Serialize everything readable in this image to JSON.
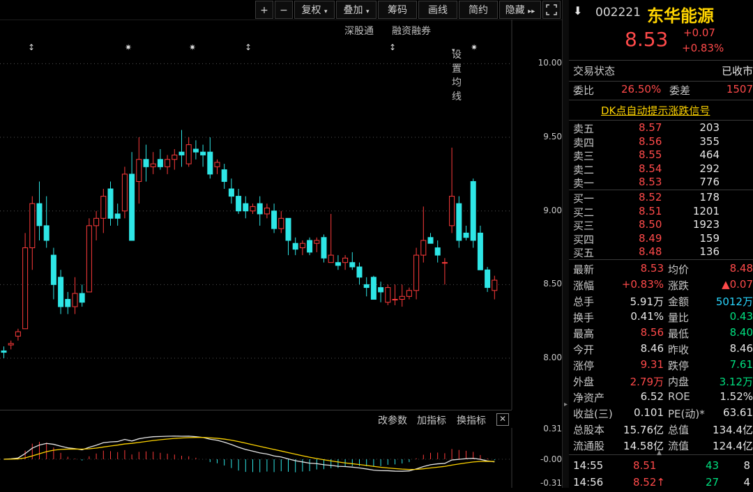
{
  "toolbar": {
    "plus": "+",
    "minus": "−",
    "fuquan": "复权",
    "diejia": "叠加",
    "chouma": "筹码",
    "huaxian": "画线",
    "jianyue": "简约",
    "yincang": "隐藏",
    "expand_icon": "expand-icon"
  },
  "subbar": {
    "shengutong": "深股通",
    "rongzi": "融资融券",
    "junxian": "设置均线"
  },
  "macd_bar": {
    "gaicanshu": "改参数",
    "jiazhibiao": "加指标",
    "huanzhibiao": "换指标"
  },
  "stock": {
    "code": "002221",
    "name": "东华能源",
    "price": "8.53",
    "change": "+0.07",
    "change_pct": "+0.83%"
  },
  "status": {
    "label": "交易状态",
    "value": "已收市"
  },
  "ratio": {
    "wb_label": "委比",
    "wb_value": "26.50%",
    "wc_label": "委差",
    "wc_value": "1507"
  },
  "dk_link": "DK点自动提示涨跌信号",
  "sell": [
    {
      "label": "卖五",
      "price": "8.57",
      "vol": "203"
    },
    {
      "label": "卖四",
      "price": "8.56",
      "vol": "355"
    },
    {
      "label": "卖三",
      "price": "8.55",
      "vol": "464"
    },
    {
      "label": "卖二",
      "price": "8.54",
      "vol": "292"
    },
    {
      "label": "卖一",
      "price": "8.53",
      "vol": "776"
    }
  ],
  "buy": [
    {
      "label": "买一",
      "price": "8.52",
      "vol": "178"
    },
    {
      "label": "买二",
      "price": "8.51",
      "vol": "1201"
    },
    {
      "label": "买三",
      "price": "8.50",
      "vol": "1923"
    },
    {
      "label": "买四",
      "price": "8.49",
      "vol": "159"
    },
    {
      "label": "买五",
      "price": "8.48",
      "vol": "136"
    }
  ],
  "stats": [
    {
      "l1": "最新",
      "v1": "8.53",
      "c1": "red",
      "l2": "均价",
      "v2": "8.48",
      "c2": "red"
    },
    {
      "l1": "涨幅",
      "v1": "+0.83%",
      "c1": "red",
      "l2": "涨跌",
      "v2": "▲0.07",
      "c2": "red"
    },
    {
      "l1": "总手",
      "v1": "5.91万",
      "c1": "white",
      "l2": "金额",
      "v2": "5012万",
      "c2": "cyan"
    },
    {
      "l1": "换手",
      "v1": "0.41%",
      "c1": "white",
      "l2": "量比",
      "v2": "0.43",
      "c2": "green"
    },
    {
      "l1": "最高",
      "v1": "8.56",
      "c1": "red",
      "l2": "最低",
      "v2": "8.40",
      "c2": "green"
    },
    {
      "l1": "今开",
      "v1": "8.46",
      "c1": "white",
      "l2": "昨收",
      "v2": "8.46",
      "c2": "white"
    },
    {
      "l1": "涨停",
      "v1": "9.31",
      "c1": "red",
      "l2": "跌停",
      "v2": "7.61",
      "c2": "green"
    },
    {
      "l1": "外盘",
      "v1": "2.79万",
      "c1": "red",
      "l2": "内盘",
      "v2": "3.12万",
      "c2": "green"
    },
    {
      "l1": "净资产",
      "v1": "6.52",
      "c1": "white",
      "l2": "ROE",
      "v2": "1.52%",
      "c2": "white"
    },
    {
      "l1": "收益(三)",
      "v1": "0.101",
      "c1": "white",
      "l2": "PE(动)*",
      "v2": "63.61",
      "c2": "white"
    },
    {
      "l1": "总股本",
      "v1": "15.76亿",
      "c1": "white",
      "l2": "总值",
      "v2": "134.4亿",
      "c2": "white"
    },
    {
      "l1": "流通股",
      "v1": "14.58亿",
      "c1": "white",
      "l2": "流值",
      "v2": "124.4亿",
      "c2": "white"
    }
  ],
  "ticks": [
    {
      "time": "14:55",
      "price": "8.51",
      "vol": "43",
      "extra": "8"
    },
    {
      "time": "14:56",
      "price": "8.52↑",
      "vol": "27",
      "extra": "4"
    }
  ],
  "chart_data": {
    "type": "candlestick",
    "ytick_labels": [
      "10.00",
      "9.50",
      "9.00",
      "8.50",
      "8.00"
    ],
    "ylim": [
      7.65,
      10.3
    ],
    "candles": [
      [
        8.05,
        8.08,
        8.0,
        8.04
      ],
      [
        8.09,
        8.12,
        8.06,
        8.1
      ],
      [
        8.15,
        8.2,
        8.12,
        8.18
      ],
      [
        8.2,
        8.85,
        8.2,
        8.75
      ],
      [
        8.75,
        9.1,
        8.6,
        9.05
      ],
      [
        9.05,
        9.2,
        8.8,
        8.9
      ],
      [
        8.9,
        9.1,
        8.75,
        8.8
      ],
      [
        8.7,
        8.75,
        8.4,
        8.5
      ],
      [
        8.55,
        8.6,
        8.3,
        8.35
      ],
      [
        8.4,
        8.45,
        8.3,
        8.35
      ],
      [
        8.35,
        8.55,
        8.3,
        8.44
      ],
      [
        8.44,
        8.5,
        8.35,
        8.38
      ],
      [
        8.45,
        8.95,
        8.45,
        8.9
      ],
      [
        8.9,
        9.0,
        8.8,
        8.95
      ],
      [
        8.95,
        9.15,
        8.85,
        9.1
      ],
      [
        9.15,
        9.2,
        8.9,
        8.95
      ],
      [
        8.98,
        9.05,
        8.9,
        8.95
      ],
      [
        9.0,
        9.3,
        8.95,
        9.25
      ],
      [
        9.25,
        9.4,
        8.95,
        8.8
      ],
      [
        9.2,
        9.5,
        9.05,
        9.35
      ],
      [
        9.35,
        9.45,
        9.2,
        9.3
      ],
      [
        9.3,
        9.4,
        9.25,
        9.32
      ],
      [
        9.35,
        9.42,
        9.28,
        9.3
      ],
      [
        9.3,
        9.38,
        9.25,
        9.35
      ],
      [
        9.35,
        9.42,
        9.28,
        9.38
      ],
      [
        9.4,
        9.55,
        9.3,
        9.38
      ],
      [
        9.32,
        9.5,
        9.3,
        9.45
      ],
      [
        9.42,
        9.48,
        9.35,
        9.4
      ],
      [
        9.4,
        9.45,
        9.3,
        9.38
      ],
      [
        9.4,
        9.5,
        9.22,
        9.25
      ],
      [
        9.3,
        9.35,
        9.25,
        9.33
      ],
      [
        9.28,
        9.32,
        9.15,
        9.2
      ],
      [
        9.15,
        9.22,
        9.05,
        9.1
      ],
      [
        9.1,
        9.15,
        8.98,
        9.0
      ],
      [
        9.05,
        9.1,
        8.95,
        9.0
      ],
      [
        9.0,
        9.05,
        8.98,
        9.03
      ],
      [
        9.05,
        9.1,
        8.9,
        8.98
      ],
      [
        8.98,
        9.05,
        8.95,
        9.02
      ],
      [
        9.0,
        9.05,
        8.85,
        8.88
      ],
      [
        8.88,
        9.0,
        8.85,
        8.95
      ],
      [
        8.95,
        8.95,
        8.7,
        8.8
      ],
      [
        8.78,
        8.82,
        8.7,
        8.74
      ],
      [
        8.75,
        8.8,
        8.7,
        8.78
      ],
      [
        8.8,
        8.82,
        8.7,
        8.72
      ],
      [
        8.78,
        8.82,
        8.72,
        8.8
      ],
      [
        8.82,
        8.84,
        8.65,
        8.68
      ],
      [
        8.65,
        8.98,
        8.65,
        8.7
      ],
      [
        8.65,
        8.7,
        8.6,
        8.63
      ],
      [
        8.65,
        8.7,
        8.6,
        8.68
      ],
      [
        8.65,
        8.72,
        8.6,
        8.62
      ],
      [
        8.62,
        8.65,
        8.5,
        8.55
      ],
      [
        8.5,
        8.55,
        8.42,
        8.48
      ],
      [
        8.55,
        8.56,
        8.4,
        8.4
      ],
      [
        8.48,
        8.52,
        8.38,
        8.45
      ],
      [
        8.38,
        8.5,
        8.36,
        8.48
      ],
      [
        8.4,
        8.5,
        8.36,
        8.4
      ],
      [
        8.4,
        8.5,
        8.35,
        8.42
      ],
      [
        8.42,
        8.48,
        8.4,
        8.46
      ],
      [
        8.46,
        8.75,
        8.4,
        8.7
      ],
      [
        8.7,
        9.03,
        8.65,
        8.8
      ],
      [
        8.82,
        8.85,
        8.78,
        8.78
      ],
      [
        8.75,
        8.8,
        8.65,
        8.7
      ],
      [
        8.65,
        8.68,
        8.5,
        8.65
      ],
      [
        8.9,
        9.43,
        8.85,
        9.1
      ],
      [
        9.05,
        9.1,
        8.75,
        8.8
      ],
      [
        8.85,
        8.9,
        8.8,
        8.82
      ],
      [
        9.2,
        9.22,
        8.75,
        8.8
      ],
      [
        8.85,
        8.9,
        8.6,
        8.6
      ],
      [
        8.6,
        8.62,
        8.45,
        8.48
      ],
      [
        8.46,
        8.56,
        8.4,
        8.53
      ]
    ]
  }
}
